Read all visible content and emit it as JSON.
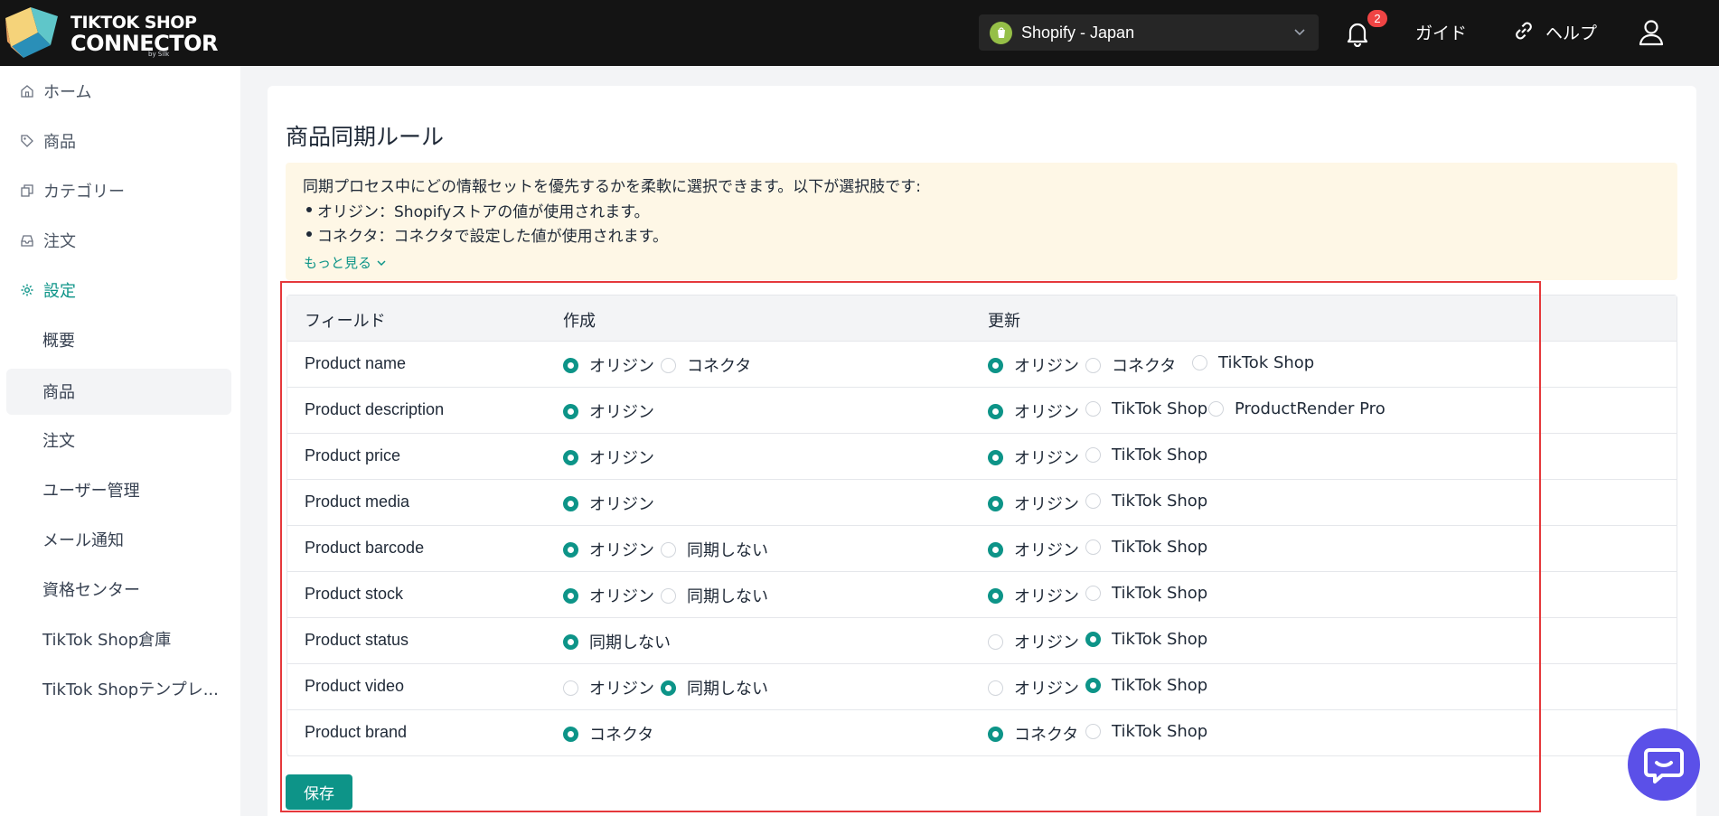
{
  "header": {
    "logo_line1": "TIKTOK SHOP",
    "logo_line2": "CONNECTOR",
    "logo_sub": "by Silk",
    "store": "Shopify - Japan",
    "notification_count": "2",
    "guide": "ガイド",
    "help": "ヘルプ"
  },
  "sidebar": {
    "nav": [
      {
        "label": "ホーム",
        "icon": "home-icon"
      },
      {
        "label": "商品",
        "icon": "tag-icon"
      },
      {
        "label": "カテゴリー",
        "icon": "copy-icon"
      },
      {
        "label": "注文",
        "icon": "inbox-icon"
      },
      {
        "label": "設定",
        "icon": "gear-icon"
      }
    ],
    "sub": [
      "概要",
      "商品",
      "注文",
      "ユーザー管理",
      "メール通知",
      "資格センター",
      "TikTok Shop倉庫",
      "TikTok Shopテンプレ..."
    ]
  },
  "main": {
    "title": "商品同期ルール",
    "notice": {
      "intro": "同期プロセス中にどの情報セットを優先するかを柔軟に選択できます。以下が選択肢です:",
      "bullets": [
        "オリジン：Shopifyストアの値が使用されます。",
        "コネクタ：コネクタで設定した値が使用されます。"
      ],
      "more": "もっと見る"
    },
    "table": {
      "headers": [
        "フィールド",
        "作成",
        "更新"
      ],
      "rows": [
        {
          "field": "Product name",
          "create": [
            {
              "label": "オリジン",
              "on": true
            },
            {
              "label": "コネクタ",
              "on": false
            }
          ],
          "update": [
            {
              "label": "オリジン",
              "on": true
            },
            {
              "label": "コネクタ",
              "on": false
            },
            {
              "label": "TikTok Shop",
              "on": false
            }
          ]
        },
        {
          "field": "Product description",
          "create": [
            {
              "label": "オリジン",
              "on": true
            }
          ],
          "update": [
            {
              "label": "オリジン",
              "on": true
            },
            {
              "label": "TikTok Shop",
              "on": false
            },
            {
              "label": "ProductRender Pro",
              "on": false
            }
          ]
        },
        {
          "field": "Product price",
          "create": [
            {
              "label": "オリジン",
              "on": true
            }
          ],
          "update": [
            {
              "label": "オリジン",
              "on": true
            },
            {
              "label": "TikTok Shop",
              "on": false
            }
          ]
        },
        {
          "field": "Product media",
          "create": [
            {
              "label": "オリジン",
              "on": true
            }
          ],
          "update": [
            {
              "label": "オリジン",
              "on": true
            },
            {
              "label": "TikTok Shop",
              "on": false
            }
          ]
        },
        {
          "field": "Product barcode",
          "create": [
            {
              "label": "オリジン",
              "on": true
            },
            {
              "label": "同期しない",
              "on": false
            }
          ],
          "update": [
            {
              "label": "オリジン",
              "on": true
            },
            {
              "label": "TikTok Shop",
              "on": false
            }
          ]
        },
        {
          "field": "Product stock",
          "create": [
            {
              "label": "オリジン",
              "on": true
            },
            {
              "label": "同期しない",
              "on": false
            }
          ],
          "update": [
            {
              "label": "オリジン",
              "on": true
            },
            {
              "label": "TikTok Shop",
              "on": false
            }
          ]
        },
        {
          "field": "Product status",
          "create": [
            {
              "label": "同期しない",
              "on": true
            }
          ],
          "update": [
            {
              "label": "オリジン",
              "on": false
            },
            {
              "label": "TikTok Shop",
              "on": true
            }
          ]
        },
        {
          "field": "Product video",
          "create": [
            {
              "label": "オリジン",
              "on": false
            },
            {
              "label": "同期しない",
              "on": true
            }
          ],
          "update": [
            {
              "label": "オリジン",
              "on": false
            },
            {
              "label": "TikTok Shop",
              "on": true
            }
          ]
        },
        {
          "field": "Product brand",
          "create": [
            {
              "label": "コネクタ",
              "on": true
            }
          ],
          "update": [
            {
              "label": "コネクタ",
              "on": true
            },
            {
              "label": "TikTok Shop",
              "on": false
            }
          ]
        }
      ]
    },
    "save": "保存"
  },
  "colors": {
    "accent": "#0d9488",
    "header_bg": "#141414",
    "notice_bg": "#fef7e6",
    "highlight": "#e5383b",
    "chat": "#5b50e8"
  }
}
